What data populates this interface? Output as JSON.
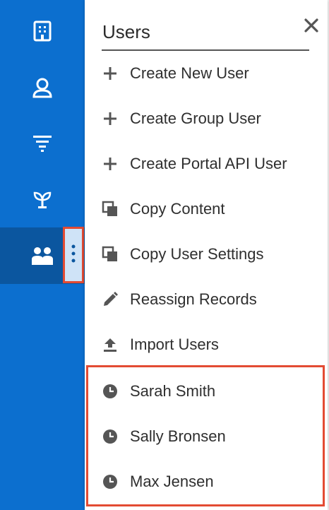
{
  "sidebar": {
    "items": [
      {
        "icon": "building-icon"
      },
      {
        "icon": "contact-icon"
      },
      {
        "icon": "filter-icon"
      },
      {
        "icon": "sprout-icon"
      },
      {
        "icon": "users-icon",
        "active": true
      }
    ],
    "kebab_icon": "vertical-dots-icon"
  },
  "panel": {
    "title": "Users",
    "close_icon": "close-icon",
    "menu_items": [
      {
        "label": "Create New User",
        "icon": "plus-icon"
      },
      {
        "label": "Create Group User",
        "icon": "plus-icon"
      },
      {
        "label": "Create Portal API User",
        "icon": "plus-icon"
      },
      {
        "label": "Copy Content",
        "icon": "copy-icon"
      },
      {
        "label": "Copy User Settings",
        "icon": "copy-icon"
      },
      {
        "label": "Reassign Records",
        "icon": "pencil-icon"
      },
      {
        "label": "Import Users",
        "icon": "upload-icon"
      }
    ],
    "recent_items": [
      {
        "label": "Sarah Smith",
        "icon": "clock-icon"
      },
      {
        "label": "Sally Bronsen",
        "icon": "clock-icon"
      },
      {
        "label": "Max Jensen",
        "icon": "clock-icon"
      }
    ]
  },
  "colors": {
    "sidebar": "#0c6fcf",
    "sidebar_active": "#0b569f",
    "highlight_border": "#e34b33",
    "text": "#2f2f2f",
    "icon": "#555555"
  }
}
